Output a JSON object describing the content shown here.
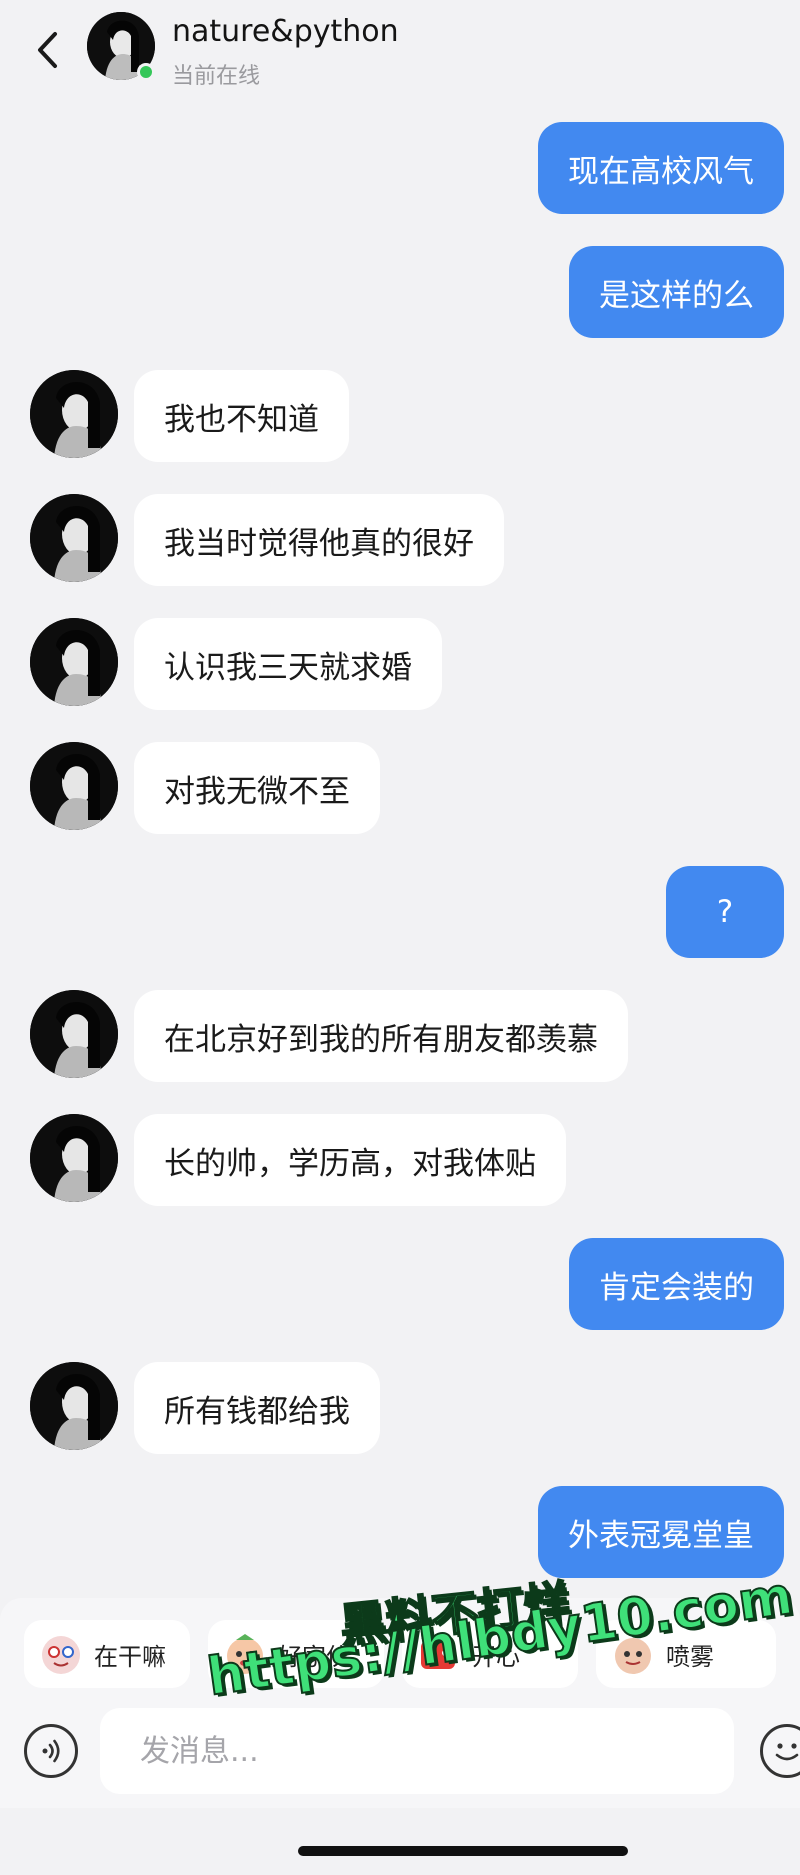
{
  "header": {
    "back_icon": "chevron-left-icon",
    "contact_name": "nature&python",
    "status": "当前在线",
    "online_color": "#35c759"
  },
  "colors": {
    "background": "#f2f2f4",
    "outgoing_bubble": "#4289f0",
    "incoming_bubble": "#ffffff"
  },
  "messages": [
    {
      "from": "me",
      "text": "现在高校风气"
    },
    {
      "from": "me",
      "text": "是这样的么"
    },
    {
      "from": "them",
      "text": "我也不知道"
    },
    {
      "from": "them",
      "text": "我当时觉得他真的很好"
    },
    {
      "from": "them",
      "text": "认识我三天就求婚"
    },
    {
      "from": "them",
      "text": "对我无微不至"
    },
    {
      "from": "me",
      "text": "?"
    },
    {
      "from": "them",
      "text": "在北京好到我的所有朋友都羡慕"
    },
    {
      "from": "them",
      "text": "长的帅，学历高，对我体贴"
    },
    {
      "from": "me",
      "text": "肯定会装的"
    },
    {
      "from": "them",
      "text": "所有钱都给我"
    },
    {
      "from": "me",
      "text": "外表冠冕堂皇"
    }
  ],
  "quick_replies": [
    {
      "label": "在干嘛",
      "icon": "sticker-icon"
    },
    {
      "label": "好家伙",
      "icon": "sticker-icon"
    },
    {
      "label": "开心",
      "icon": "sticker-icon"
    },
    {
      "label": "喷雾",
      "icon": "sticker-icon"
    }
  ],
  "input": {
    "placeholder": "发消息...",
    "voice_icon": "voice-icon",
    "emoji_icon": "emoji-icon"
  },
  "watermark": {
    "line1": "黑料不打烊",
    "line2": "https://hlbdy10.com",
    "color": "#3fe079"
  }
}
